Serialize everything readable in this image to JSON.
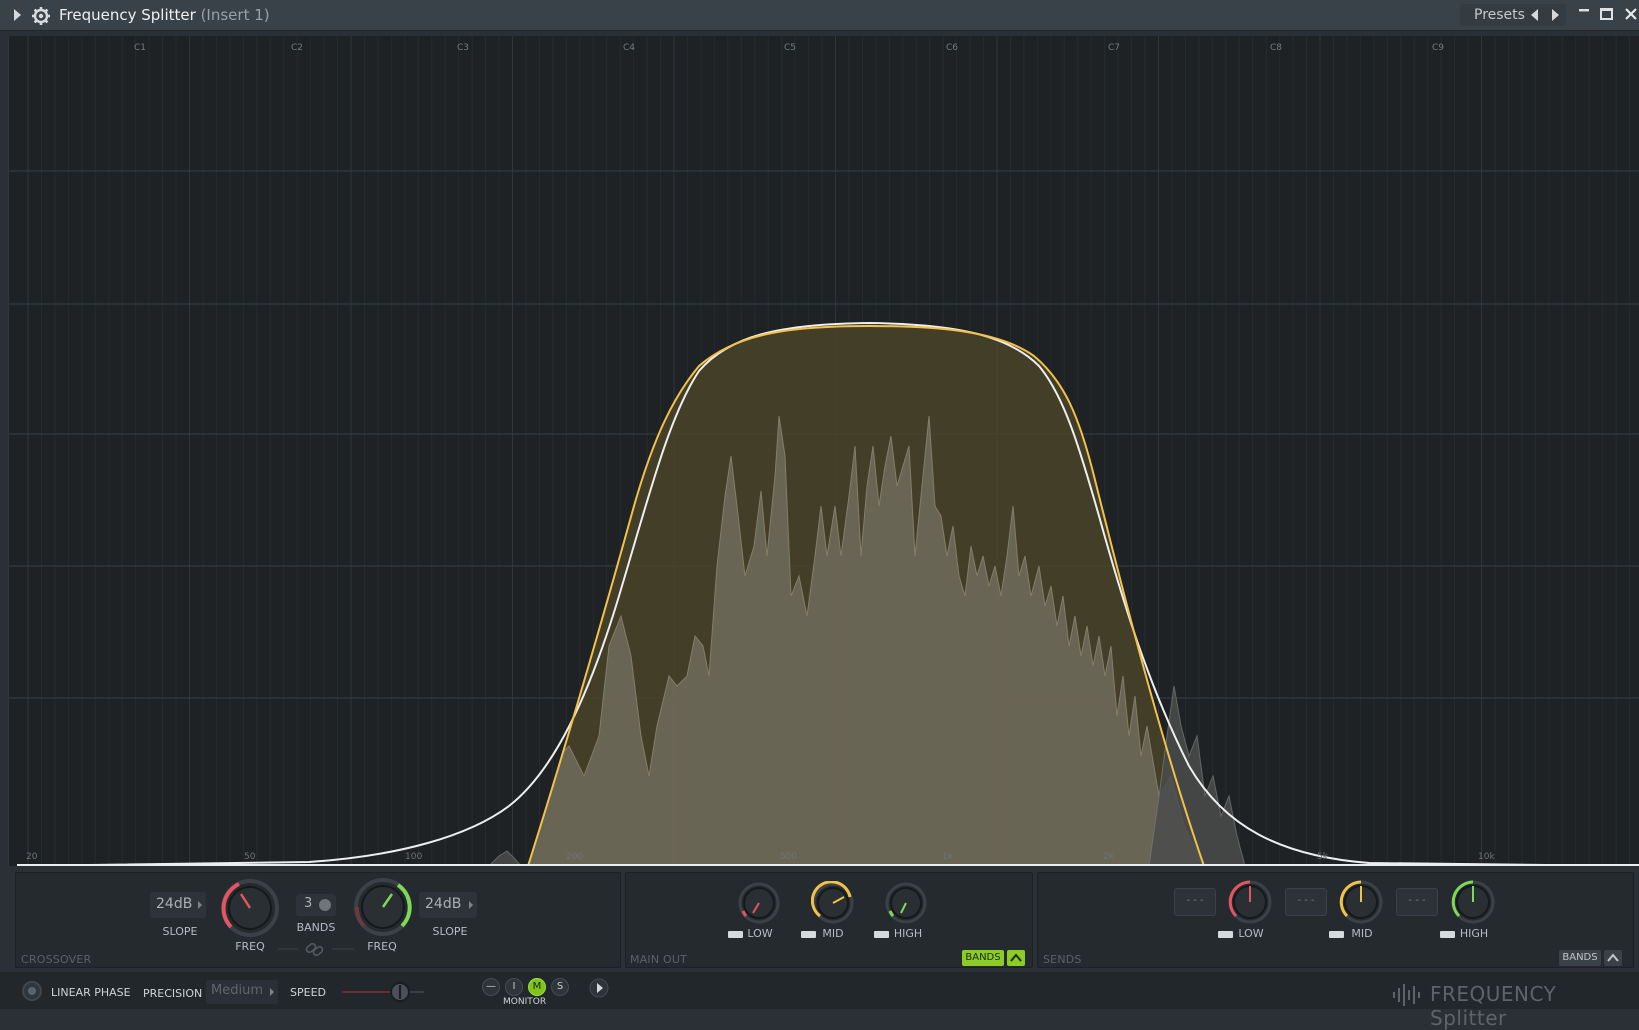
{
  "window": {
    "title": "Frequency Splitter",
    "subtitle": "(Insert 1)",
    "presets_label": "Presets"
  },
  "graph": {
    "note_labels": [
      "C1",
      "C2",
      "C3",
      "C4",
      "C5",
      "C6",
      "C7",
      "C8",
      "C9"
    ],
    "freq_labels": [
      "20",
      "50",
      "100",
      "200",
      "500",
      "1k",
      "2k",
      "5k",
      "10k"
    ],
    "colors": {
      "band_curve": "#f2c14a",
      "outer_curve": "#f0f0f0",
      "band_fill": "#554b2c",
      "spectrum_fill": "#6b6656",
      "background": "#1e2224"
    }
  },
  "crossover": {
    "title": "CROSSOVER",
    "left_slope": "24dB",
    "right_slope": "24dB",
    "slope_label": "SLOPE",
    "freq_label": "FREQ",
    "bands_value": "3",
    "bands_label": "BANDS",
    "link_icon": "link-icon"
  },
  "main_out": {
    "title": "MAIN OUT",
    "low_label": "LOW",
    "mid_label": "MID",
    "high_label": "HIGH",
    "bands_button": "BANDS",
    "colors": {
      "low": "#e25563",
      "mid": "#f2c14a",
      "high": "#7ed957"
    }
  },
  "sends": {
    "title": "SENDS",
    "low_label": "LOW",
    "mid_label": "MID",
    "high_label": "HIGH",
    "slot_text": "- - -",
    "bands_button": "BANDS"
  },
  "bottom": {
    "linear_phase": "LINEAR PHASE",
    "precision_label": "PRECISION",
    "precision_value": "Medium",
    "speed_label": "SPEED",
    "monitor_label": "MONITOR",
    "monitor_buttons": [
      "—",
      "I",
      "M",
      "S"
    ],
    "brand": "FREQUENCY Splitter"
  }
}
